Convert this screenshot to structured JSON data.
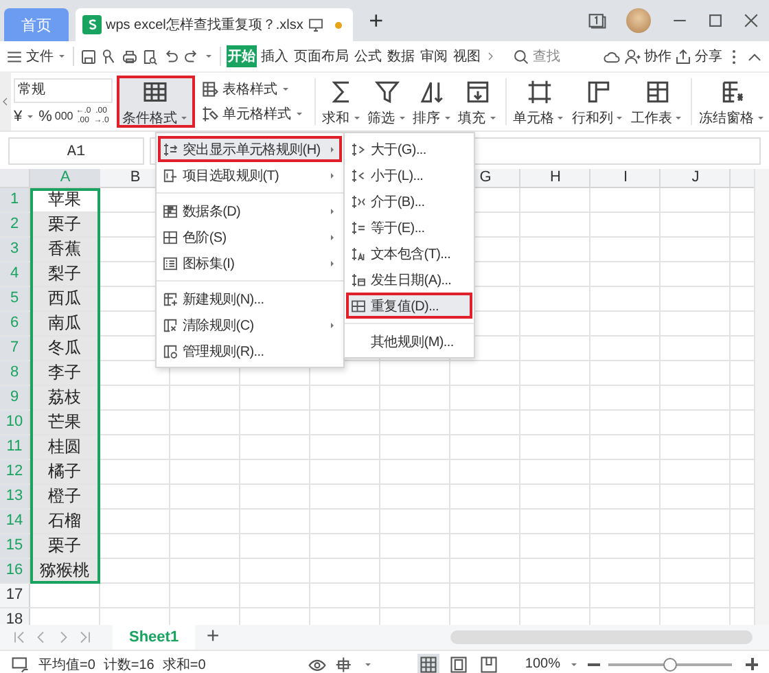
{
  "tabs": [
    {
      "label": "首页",
      "kind": "home",
      "selected": false
    },
    {
      "label": "wps excel怎样查找重复项？.xlsx",
      "kind": "doc",
      "selected": true,
      "unsaved": true
    }
  ],
  "new_tab": "+",
  "menu_bar": {
    "file": "文件",
    "tabs": [
      {
        "label": "开始",
        "selected": true
      },
      {
        "label": "插入",
        "selected": false
      },
      {
        "label": "页面布局",
        "selected": false
      },
      {
        "label": "公式",
        "selected": false
      },
      {
        "label": "数据",
        "selected": false
      },
      {
        "label": "审阅",
        "selected": false
      },
      {
        "label": "视图",
        "selected": false
      }
    ],
    "search": "查找",
    "collab": "协作",
    "share": "分享"
  },
  "ribbon": {
    "number_format": "常规",
    "currency": "¥",
    "percent": "%",
    "thousands": "000",
    "decimals": [
      {
        "top": "←.0",
        "bottom": ".00"
      },
      {
        "top": ".00",
        "bottom": "→.0"
      }
    ],
    "conditional_format": {
      "label": "条件格式",
      "active": true
    },
    "style_buttons": [
      {
        "label": "表格样式",
        "kind": "tablestyle"
      },
      {
        "label": "单元格样式",
        "kind": "cellstyle"
      }
    ],
    "groups": [
      [
        {
          "label": "求和",
          "kind": "sum"
        },
        {
          "label": "筛选",
          "kind": "filter"
        },
        {
          "label": "排序",
          "kind": "sort"
        },
        {
          "label": "填充",
          "kind": "fill"
        }
      ],
      [
        {
          "label": "单元格",
          "kind": "cell"
        },
        {
          "label": "行和列",
          "kind": "rowcol"
        },
        {
          "label": "工作表",
          "kind": "sheet"
        }
      ],
      [
        {
          "label": "冻结窗格",
          "kind": "freeze"
        }
      ]
    ]
  },
  "formula_bar": {
    "name_box": "A1"
  },
  "sheet": {
    "columns": [
      "A",
      "B",
      "G",
      "H",
      "I",
      "J"
    ],
    "rows": [
      {
        "num": "1",
        "value": "苹果",
        "selected": true,
        "active": true
      },
      {
        "num": "2",
        "value": "栗子",
        "selected": true,
        "active": false
      },
      {
        "num": "3",
        "value": "香蕉",
        "selected": true,
        "active": false
      },
      {
        "num": "4",
        "value": "梨子",
        "selected": true,
        "active": false
      },
      {
        "num": "5",
        "value": "西瓜",
        "selected": true,
        "active": false
      },
      {
        "num": "6",
        "value": "南瓜",
        "selected": true,
        "active": false
      },
      {
        "num": "7",
        "value": "冬瓜",
        "selected": true,
        "active": false
      },
      {
        "num": "8",
        "value": "李子",
        "selected": true,
        "active": false
      },
      {
        "num": "9",
        "value": "荔枝",
        "selected": true,
        "active": false
      },
      {
        "num": "10",
        "value": "芒果",
        "selected": true,
        "active": false
      },
      {
        "num": "11",
        "value": "桂圆",
        "selected": true,
        "active": false
      },
      {
        "num": "12",
        "value": "橘子",
        "selected": true,
        "active": false
      },
      {
        "num": "13",
        "value": "橙子",
        "selected": true,
        "active": false
      },
      {
        "num": "14",
        "value": "石榴",
        "selected": true,
        "active": false
      },
      {
        "num": "15",
        "value": "栗子",
        "selected": true,
        "active": false
      },
      {
        "num": "16",
        "value": "猕猴桃",
        "selected": true,
        "active": false
      },
      {
        "num": "17",
        "selected": false
      },
      {
        "num": "18",
        "selected": false
      }
    ]
  },
  "menu": [
    {
      "label": "突出显示单元格规则(H)",
      "kind": "highlight",
      "submenu": true,
      "selected": true
    },
    {
      "label": "项目选取规则(T)",
      "kind": "top10",
      "submenu": true,
      "selected": false
    },
    {
      "label": "数据条(D)",
      "kind": "databar",
      "submenu": true,
      "selected": false,
      "separator_before": true
    },
    {
      "label": "色阶(S)",
      "kind": "colorscale",
      "submenu": true,
      "selected": false
    },
    {
      "label": "图标集(I)",
      "kind": "iconset",
      "submenu": true,
      "selected": false
    },
    {
      "label": "新建规则(N)...",
      "kind": "newrule",
      "submenu": false,
      "selected": false,
      "separator_before": true
    },
    {
      "label": "清除规则(C)",
      "kind": "clearrule",
      "submenu": true,
      "selected": false
    },
    {
      "label": "管理规则(R)...",
      "kind": "managerule",
      "submenu": false,
      "selected": false
    }
  ],
  "submenu": [
    {
      "label": "大于(G)...",
      "kind": "gt",
      "selected": false
    },
    {
      "label": "小于(L)...",
      "kind": "lt",
      "selected": false
    },
    {
      "label": "介于(B)...",
      "kind": "between",
      "selected": false
    },
    {
      "label": "等于(E)...",
      "kind": "eq",
      "selected": false
    },
    {
      "label": "文本包含(T)...",
      "kind": "text",
      "selected": false
    },
    {
      "label": "发生日期(A)...",
      "kind": "date",
      "selected": false
    },
    {
      "label": "重复值(D)...",
      "kind": "dup",
      "selected": true
    },
    {
      "label": "其他规则(M)...",
      "kind": "plain",
      "selected": false,
      "separator_before": true
    }
  ],
  "sheet_tabs": [
    {
      "label": "Sheet1",
      "selected": true
    }
  ],
  "add_sheet": "+",
  "status_bar": {
    "stats": [
      "平均值=0",
      "计数=16",
      "求和=0"
    ],
    "views": [
      {
        "kind": "normal",
        "selected": true
      },
      {
        "kind": "pagebreak",
        "selected": false
      },
      {
        "kind": "reading",
        "selected": false
      }
    ],
    "zoom": "100%",
    "zoom_slider": {
      "level": 0.5
    }
  }
}
